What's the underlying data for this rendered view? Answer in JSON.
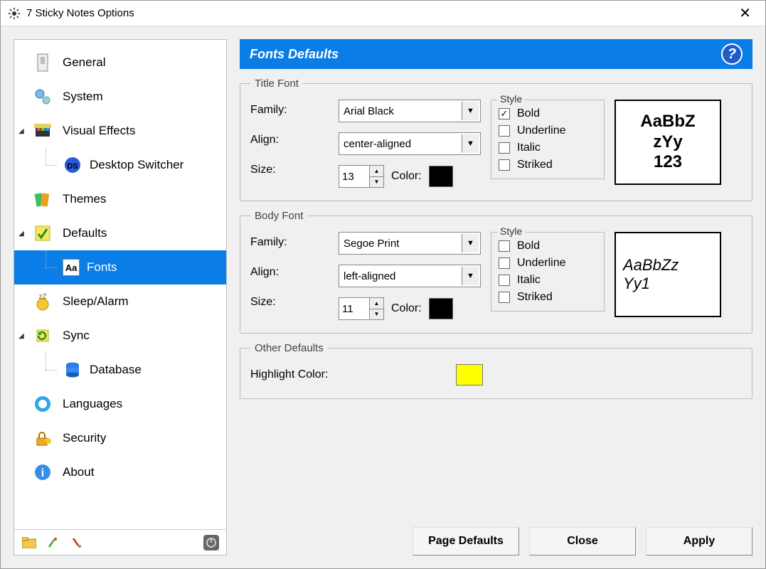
{
  "window": {
    "title": "7 Sticky Notes Options"
  },
  "sidebar": {
    "items": [
      {
        "label": "General"
      },
      {
        "label": "System"
      },
      {
        "label": "Visual Effects"
      },
      {
        "label": "Desktop Switcher"
      },
      {
        "label": "Themes"
      },
      {
        "label": "Defaults"
      },
      {
        "label": "Fonts"
      },
      {
        "label": "Sleep/Alarm"
      },
      {
        "label": "Sync"
      },
      {
        "label": "Database"
      },
      {
        "label": "Languages"
      },
      {
        "label": "Security"
      },
      {
        "label": "About"
      }
    ]
  },
  "header": {
    "title": "Fonts Defaults"
  },
  "labels": {
    "family": "Family:",
    "align": "Align:",
    "size": "Size:",
    "color": "Color:",
    "style": "Style",
    "bold": "Bold",
    "underline": "Underline",
    "italic": "Italic",
    "striked": "Striked",
    "title_font": "Title Font",
    "body_font": "Body Font",
    "other_defaults": "Other Defaults",
    "highlight_color": "Highlight Color:"
  },
  "title_font": {
    "family": "Arial Black",
    "align": "center-aligned",
    "size": "13",
    "color": "#000000",
    "style": {
      "bold": true,
      "underline": false,
      "italic": false,
      "striked": false
    },
    "preview": {
      "line1": "AaBbZ",
      "line2": "zYy",
      "line3": "123"
    }
  },
  "body_font": {
    "family": "Segoe Print",
    "align": "left-aligned",
    "size": "11",
    "color": "#000000",
    "style": {
      "bold": false,
      "underline": false,
      "italic": false,
      "striked": false
    },
    "preview": {
      "line1": "AaBbZz",
      "line2": "Yy1"
    }
  },
  "other": {
    "highlight_color": "#ffff00"
  },
  "buttons": {
    "page_defaults": "Page Defaults",
    "close": "Close",
    "apply": "Apply"
  }
}
